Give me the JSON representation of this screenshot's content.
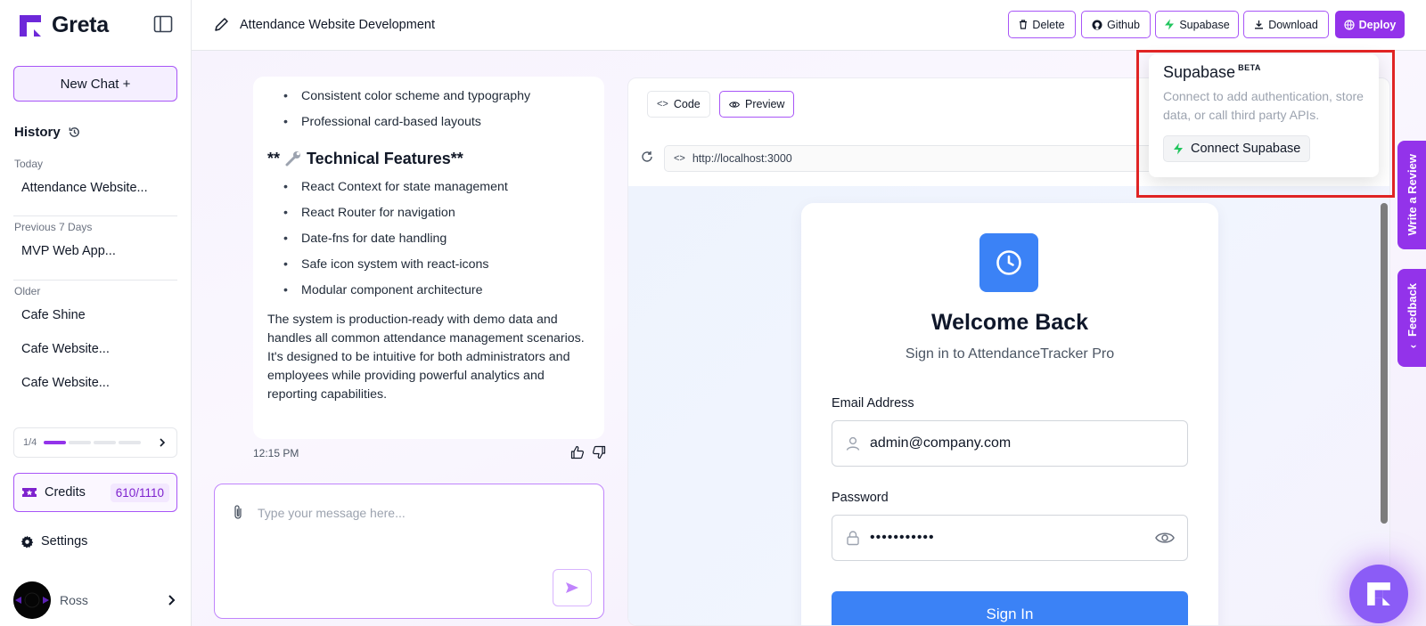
{
  "brand": {
    "name": "Greta"
  },
  "sidebar": {
    "new_chat_label": "New Chat +",
    "history_label": "History",
    "groups": [
      {
        "label": "Today",
        "items": [
          "Attendance Website..."
        ]
      },
      {
        "label": "Previous 7 Days",
        "items": [
          "MVP Web App..."
        ]
      },
      {
        "label": "Older",
        "items": [
          "Cafe Shine",
          "Cafe Website...",
          "Cafe Website..."
        ]
      }
    ],
    "pager": {
      "label": "1/4",
      "page": 1,
      "total": 4
    },
    "credits": {
      "label": "Credits",
      "value": "610/1110"
    },
    "settings_label": "Settings",
    "user": {
      "name": "Ross"
    }
  },
  "topbar": {
    "project_title": "Attendance Website Development",
    "buttons": {
      "delete": "Delete",
      "github": "Github",
      "supabase": "Supabase",
      "download": "Download",
      "deploy": "Deploy"
    }
  },
  "chat": {
    "bullets_top": [
      "Consistent color scheme and typography",
      "Professional card-based layouts"
    ],
    "heading_prefix": "**",
    "heading_text": "Technical Features**",
    "bullets_tech": [
      "React Context for state management",
      "React Router for navigation",
      "Date-fns for date handling",
      "Safe icon system with react-icons",
      "Modular component architecture"
    ],
    "paragraph": "The system is production-ready with demo data and handles all common attendance management scenarios. It's designed to be intuitive for both administrators and employees while providing powerful analytics and reporting capabilities.",
    "timestamp": "12:15 PM",
    "input_placeholder": "Type your message here..."
  },
  "preview": {
    "tabs": {
      "code": "Code",
      "preview": "Preview"
    },
    "url": "http://localhost:3000",
    "login": {
      "title": "Welcome Back",
      "subtitle": "Sign in to AttendanceTracker Pro",
      "email_label": "Email Address",
      "email_value": "admin@company.com",
      "password_label": "Password",
      "password_value": "•••••••••••",
      "signin_label": "Sign In"
    }
  },
  "popover": {
    "title": "Supabase",
    "badge": "BETA",
    "description": "Connect to add authentication, store data, or call third party APIs.",
    "button": "Connect Supabase"
  },
  "side_tabs": {
    "review": "Write a Review",
    "feedback": "Feedback"
  },
  "colors": {
    "accent": "#9333ea",
    "primary_blue": "#3b82f6",
    "supabase_green": "#22c55e",
    "highlight_red": "#e02424"
  }
}
